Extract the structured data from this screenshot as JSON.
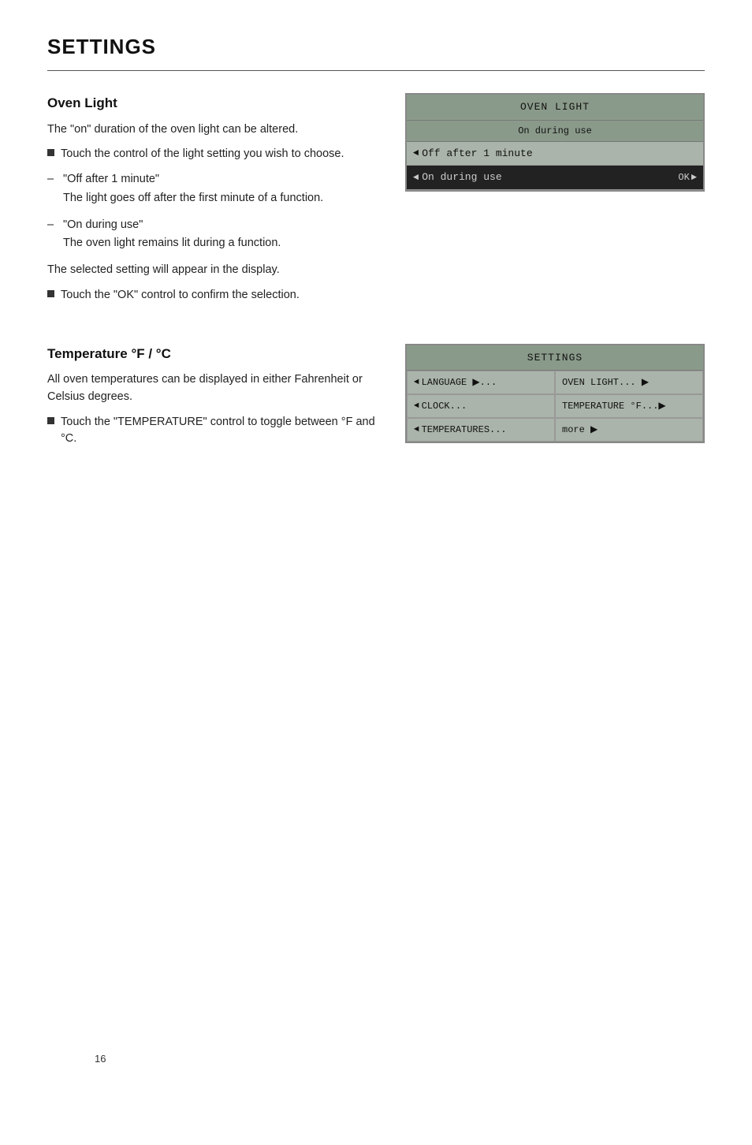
{
  "page": {
    "title": "SETTINGS",
    "page_number": "16"
  },
  "oven_light_section": {
    "title": "Oven Light",
    "description": "The \"on\" duration of the oven light can be altered.",
    "bullet1": "Touch the control of the light setting you wish to choose.",
    "dash_items": [
      {
        "title": "\"Off after 1 minute\"",
        "body": "The light goes off after the first minute of a function."
      },
      {
        "title": "\"On during use\"",
        "body": "The oven light remains lit during a function."
      }
    ],
    "note": "The selected setting will appear in the display.",
    "bullet2": "Touch the \"OK\" control to confirm the selection."
  },
  "oven_light_display": {
    "header": "OVEN LIGHT",
    "subheader": "On during use",
    "row1_text": "Off after 1 minute",
    "row2_text": "On during use",
    "ok_label": "OK"
  },
  "temperature_section": {
    "title": "Temperature °F / °C",
    "description": "All oven temperatures can be displayed in either Fahrenheit or Celsius degrees.",
    "bullet1": "Touch the \"TEMPERATURE\" control to toggle between °F and °C."
  },
  "settings_display": {
    "header": "SETTINGS",
    "cells": [
      {
        "text": "LANGUAGE ▶...",
        "arrow_left": true,
        "arrow_right": false
      },
      {
        "text": "OVEN LIGHT... ▶",
        "arrow_left": false,
        "arrow_right": false
      },
      {
        "text": "CLOCK...",
        "arrow_left": true,
        "arrow_right": false
      },
      {
        "text": "TEMPERATURE °F...▶",
        "arrow_left": false,
        "arrow_right": false
      },
      {
        "text": "TEMPERATURES...",
        "arrow_left": true,
        "arrow_right": false
      },
      {
        "text": "more ▶",
        "arrow_left": false,
        "arrow_right": false
      }
    ]
  }
}
